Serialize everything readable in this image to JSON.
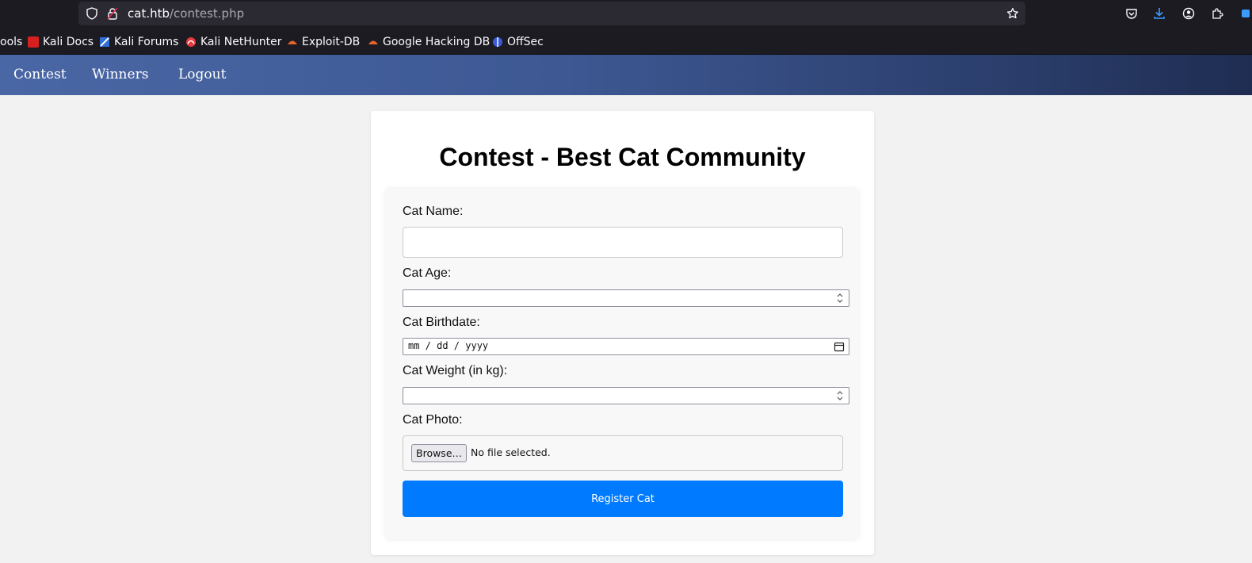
{
  "browser": {
    "url_host": "cat.htb",
    "url_path": "/contest.php",
    "bookmarks": [
      {
        "label": "ools",
        "icon": "tools-icon"
      },
      {
        "label": "Kali Docs",
        "icon": "kali-docs-icon"
      },
      {
        "label": "Kali Forums",
        "icon": "kali-forums-icon"
      },
      {
        "label": "Kali NetHunter",
        "icon": "kali-nethunter-icon"
      },
      {
        "label": "Exploit-DB",
        "icon": "exploit-db-icon"
      },
      {
        "label": "Google Hacking DB",
        "icon": "ghdb-icon"
      },
      {
        "label": "OffSec",
        "icon": "offsec-icon"
      }
    ]
  },
  "nav": {
    "contest": "Contest",
    "winners": "Winners",
    "logout": "Logout"
  },
  "page": {
    "title": "Contest - Best Cat Community"
  },
  "form": {
    "cat_name_label": "Cat Name:",
    "cat_name_value": "",
    "cat_age_label": "Cat Age:",
    "cat_age_value": "",
    "cat_birthdate_label": "Cat Birthdate:",
    "cat_birthdate_placeholder": "mm / dd / yyyy",
    "cat_weight_label": "Cat Weight (in kg):",
    "cat_weight_value": "",
    "cat_photo_label": "Cat Photo:",
    "browse_label": "Browse…",
    "file_status": "No file selected.",
    "submit_label": "Register Cat"
  },
  "colors": {
    "primary_button": "#007bff",
    "nav_gradient_start": "#4a67a5",
    "nav_gradient_end": "#1f2d52"
  }
}
